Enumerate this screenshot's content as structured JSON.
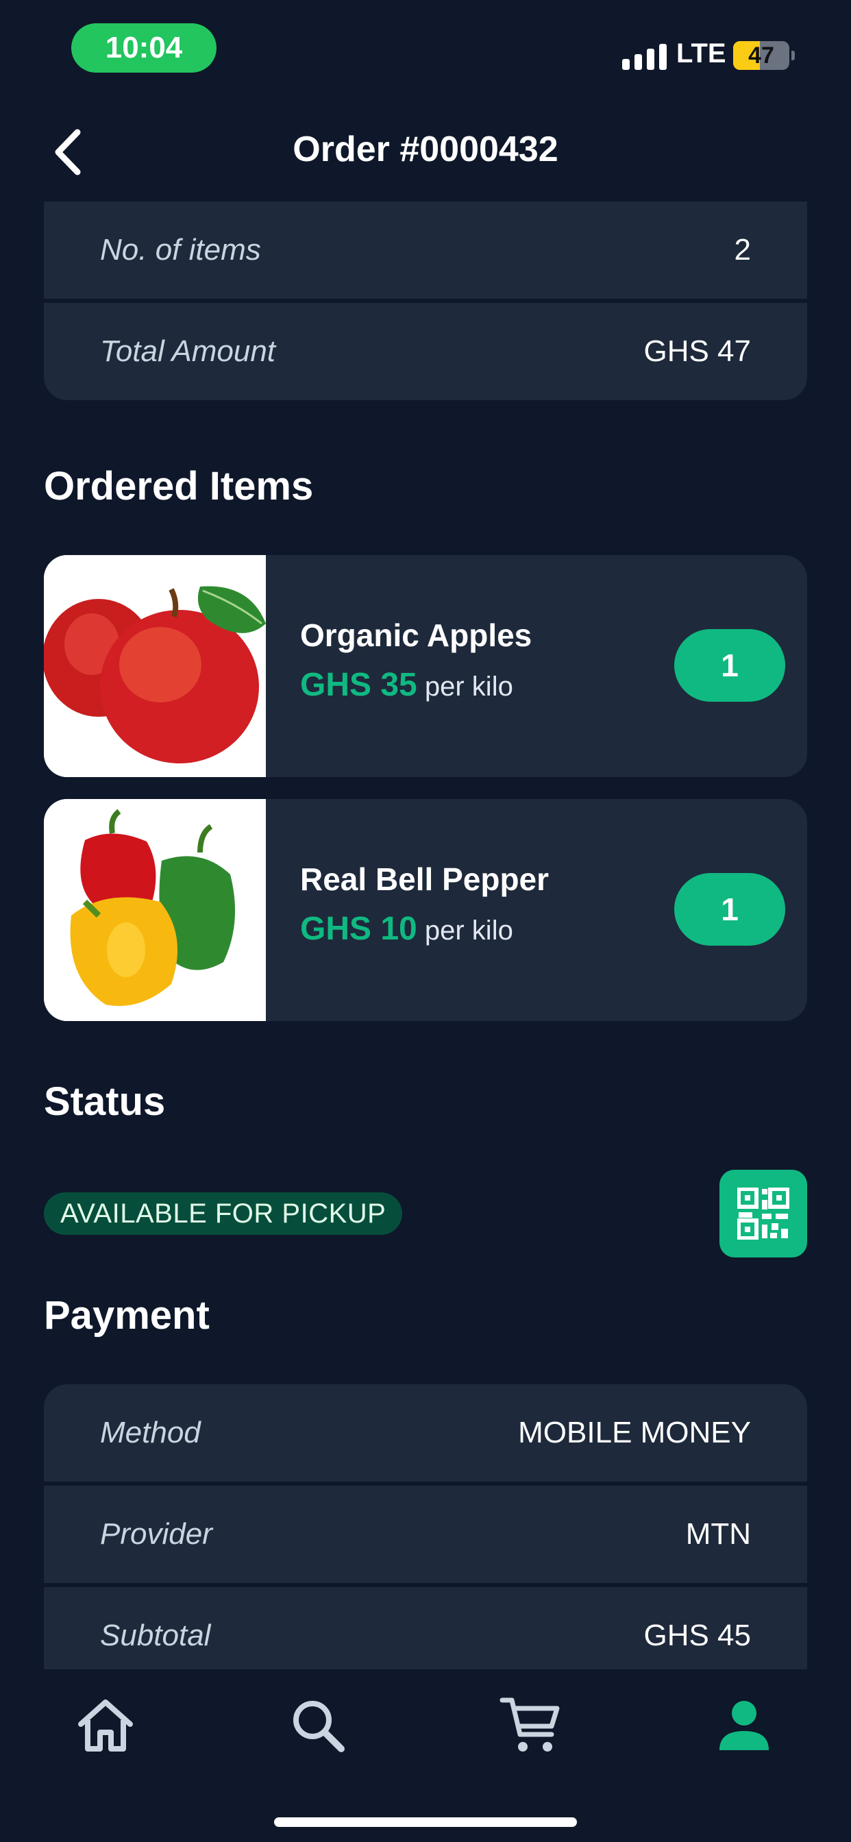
{
  "status_bar": {
    "time": "10:04",
    "network": "LTE",
    "battery": "47",
    "battery_level": 0.47
  },
  "header": {
    "title": "Order #0000432"
  },
  "summary": {
    "rows": [
      {
        "label": "No. of items",
        "value": "2"
      },
      {
        "label": "Total Amount",
        "value": "GHS 47"
      }
    ]
  },
  "ordered_items": {
    "title": "Ordered Items",
    "items": [
      {
        "name": "Organic Apples",
        "price": "GHS 35",
        "unit": "per kilo",
        "quantity": "1"
      },
      {
        "name": "Real Bell Pepper",
        "price": "GHS 10",
        "unit": "per kilo",
        "quantity": "1"
      }
    ]
  },
  "status": {
    "title": "Status",
    "badge": "AVAILABLE FOR PICKUP"
  },
  "payment": {
    "title": "Payment",
    "rows": [
      {
        "label": "Method",
        "value": "MOBILE MONEY"
      },
      {
        "label": "Provider",
        "value": "MTN"
      },
      {
        "label": "Subtotal",
        "value": "GHS 45"
      }
    ]
  },
  "nav": {
    "items": [
      "home-icon",
      "search-icon",
      "cart-icon",
      "profile-icon"
    ],
    "active": "profile-icon"
  },
  "colors": {
    "background": "#0f172a",
    "card": "#1e293b",
    "accent": "#10b981",
    "status_badge": "#064e3b"
  }
}
